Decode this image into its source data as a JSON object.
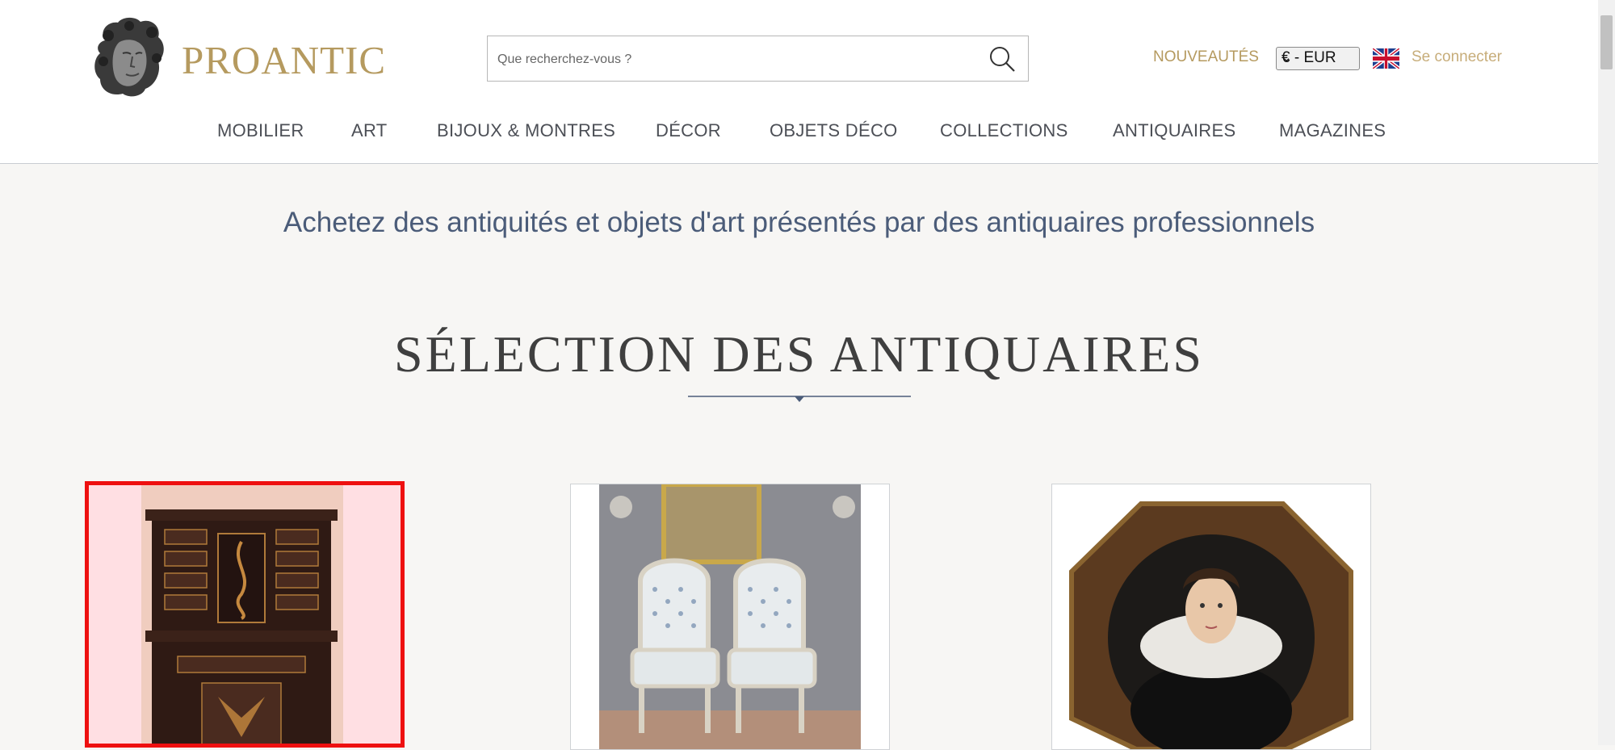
{
  "header": {
    "logo_text": "PROANTIC",
    "search_placeholder": "Que recherchez-vous ?",
    "nouveautes": "NOUVEAUTÉS",
    "currency": "€ - EUR",
    "signin": "Se connecter"
  },
  "nav": [
    "MOBILIER",
    "ART",
    "BIJOUX & MONTRES",
    "DÉCOR",
    "OBJETS DÉCO",
    "COLLECTIONS",
    "ANTIQUAIRES",
    "MAGAZINES"
  ],
  "main": {
    "tagline": "Achetez des antiquités et objets d'art présentés par des antiquaires professionnels",
    "section_title": "SÉLECTION DES ANTIQUAIRES"
  },
  "colors": {
    "gold": "#b59a5f",
    "tagline": "#4b5c79",
    "selection_border": "#ee1010"
  },
  "icons": [
    "logo-head-icon",
    "search-icon",
    "uk-flag-icon",
    "chevron-down-icon"
  ]
}
